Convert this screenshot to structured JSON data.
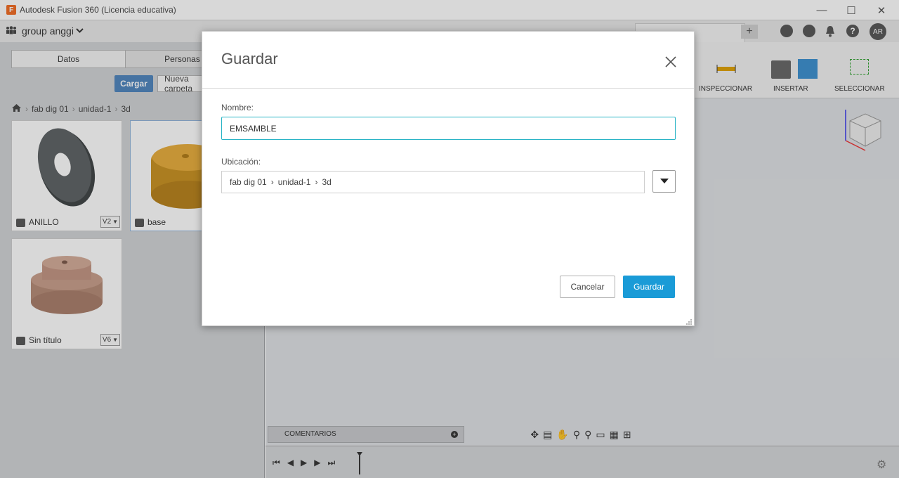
{
  "window": {
    "title": "Autodesk Fusion 360 (Licencia educativa)",
    "logo_letter": "F",
    "minimize": "—",
    "maximize": "☐",
    "close": "✕"
  },
  "data_panel": {
    "team_name": "group anggi",
    "tabs": [
      "Datos",
      "Personas"
    ],
    "upload_label": "Cargar",
    "new_folder_label": "Nueva carpeta",
    "breadcrumb": [
      "fab dig 01",
      "unidad-1",
      "3d"
    ],
    "items": [
      {
        "name": "ANILLO",
        "version": "V2"
      },
      {
        "name": "base",
        "version": ""
      },
      {
        "name": "Sin título",
        "version": "V6"
      }
    ]
  },
  "ribbon": {
    "inspect_label": "INSPECCIONAR",
    "insert_label": "INSERTAR",
    "select_label": "SELECCIONAR"
  },
  "user_initials": "AR",
  "comments_label": "COMENTARIOS",
  "dialog": {
    "title": "Guardar",
    "name_label": "Nombre:",
    "name_value": "EMSAMBLE",
    "location_label": "Ubicación:",
    "location_path": [
      "fab dig 01",
      "unidad-1",
      "3d"
    ],
    "cancel_label": "Cancelar",
    "save_label": "Guardar"
  },
  "colors": {
    "primary_button": "#1a9bd7",
    "upload_button": "#4e84be",
    "input_focus": "#29b4c6"
  }
}
